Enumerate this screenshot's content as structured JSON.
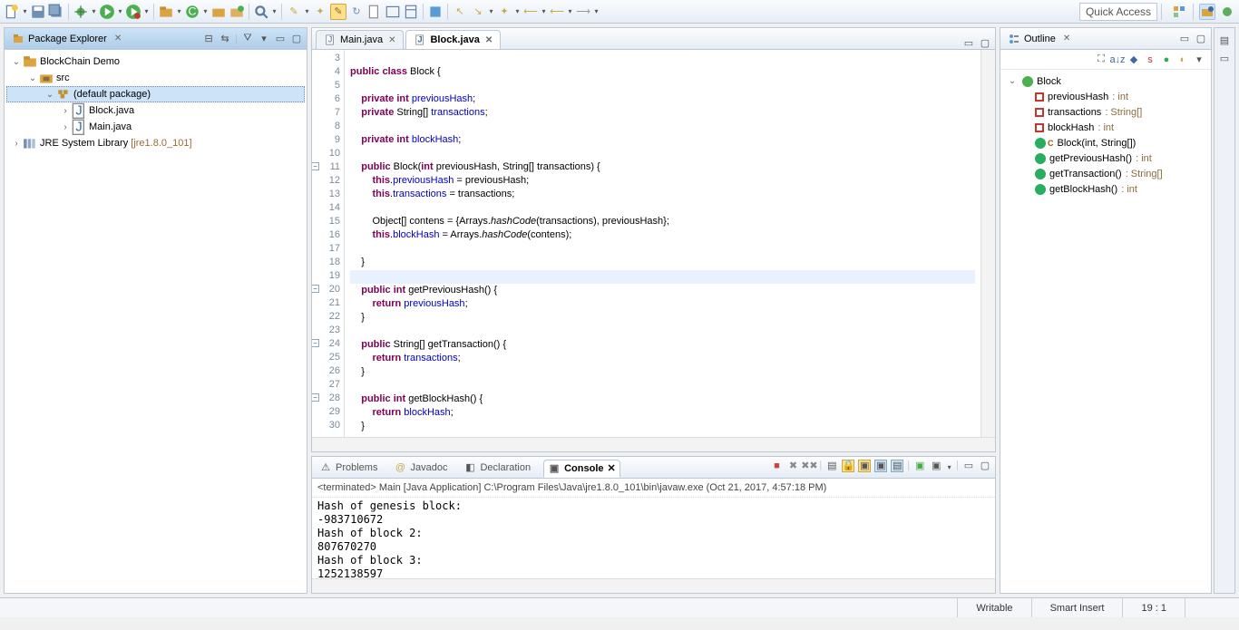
{
  "toolbar": {
    "quick_access": "Quick Access"
  },
  "packageExplorer": {
    "title": "Package Explorer",
    "project": "BlockChain Demo",
    "src": "src",
    "defaultPackage": "(default package)",
    "files": [
      "Block.java",
      "Main.java"
    ],
    "jre": "JRE System Library",
    "jreDec": "[jre1.8.0_101]"
  },
  "editor": {
    "tabs": [
      {
        "label": "Main.java",
        "active": false
      },
      {
        "label": "Block.java",
        "active": true
      }
    ],
    "startLine": 3,
    "code": [
      {
        "n": 3,
        "t": ""
      },
      {
        "n": 4,
        "html": "<span class='kw'>public</span> <span class='kw'>class</span> Block {"
      },
      {
        "n": 5,
        "t": ""
      },
      {
        "n": 6,
        "html": "    <span class='kw'>private</span> <span class='kw'>int</span> <span class='fld'>previousHash</span>;"
      },
      {
        "n": 7,
        "html": "    <span class='kw'>private</span> String[] <span class='fld'>transactions</span>;"
      },
      {
        "n": 8,
        "t": ""
      },
      {
        "n": 9,
        "html": "    <span class='kw'>private</span> <span class='kw'>int</span> <span class='fld'>blockHash</span>;"
      },
      {
        "n": 10,
        "t": ""
      },
      {
        "n": 11,
        "fold": true,
        "html": "    <span class='kw'>public</span> Block(<span class='kw'>int</span> previousHash, String[] transactions) {"
      },
      {
        "n": 12,
        "html": "        <span class='kw'>this</span>.<span class='fld'>previousHash</span> = previousHash;"
      },
      {
        "n": 13,
        "html": "        <span class='kw'>this</span>.<span class='fld'>transactions</span> = transactions;"
      },
      {
        "n": 14,
        "t": ""
      },
      {
        "n": 15,
        "html": "        Object[] contens = {Arrays.<span class='mtd'>hashCode</span>(transactions), previousHash};"
      },
      {
        "n": 16,
        "html": "        <span class='kw'>this</span>.<span class='fld'>blockHash</span> = Arrays.<span class='mtd'>hashCode</span>(contens);"
      },
      {
        "n": 17,
        "t": ""
      },
      {
        "n": 18,
        "t": "    }"
      },
      {
        "n": 19,
        "hl": true,
        "t": ""
      },
      {
        "n": 20,
        "fold": true,
        "html": "    <span class='kw'>public</span> <span class='kw'>int</span> getPreviousHash() {"
      },
      {
        "n": 21,
        "html": "        <span class='kw'>return</span> <span class='fld'>previousHash</span>;"
      },
      {
        "n": 22,
        "t": "    }"
      },
      {
        "n": 23,
        "t": ""
      },
      {
        "n": 24,
        "fold": true,
        "html": "    <span class='kw'>public</span> String[] getTransaction() {"
      },
      {
        "n": 25,
        "html": "        <span class='kw'>return</span> <span class='fld'>transactions</span>;"
      },
      {
        "n": 26,
        "t": "    }"
      },
      {
        "n": 27,
        "t": ""
      },
      {
        "n": 28,
        "fold": true,
        "html": "    <span class='kw'>public</span> <span class='kw'>int</span> getBlockHash() {"
      },
      {
        "n": 29,
        "html": "        <span class='kw'>return</span> <span class='fld'>blockHash</span>;"
      },
      {
        "n": 30,
        "t": "    }"
      }
    ]
  },
  "outline": {
    "title": "Outline",
    "root": "Block",
    "items": [
      {
        "kind": "field",
        "name": "previousHash",
        "type": "int"
      },
      {
        "kind": "field",
        "name": "transactions",
        "type": "String[]"
      },
      {
        "kind": "field",
        "name": "blockHash",
        "type": "int"
      },
      {
        "kind": "ctor",
        "name": "Block(int, String[])"
      },
      {
        "kind": "method",
        "name": "getPreviousHash()",
        "type": "int"
      },
      {
        "kind": "method",
        "name": "getTransaction()",
        "type": "String[]"
      },
      {
        "kind": "method",
        "name": "getBlockHash()",
        "type": "int"
      }
    ]
  },
  "bottomTabs": {
    "problems": "Problems",
    "javadoc": "Javadoc",
    "declaration": "Declaration",
    "console": "Console"
  },
  "console": {
    "desc": "<terminated> Main [Java Application] C:\\Program Files\\Java\\jre1.8.0_101\\bin\\javaw.exe (Oct 21, 2017, 4:57:18 PM)",
    "lines": [
      "Hash of genesis block:",
      "-983710672",
      "Hash of block 2:",
      "807670270",
      "Hash of block 3:",
      "1252138597"
    ]
  },
  "status": {
    "writable": "Writable",
    "insert": "Smart Insert",
    "pos": "19 : 1"
  }
}
